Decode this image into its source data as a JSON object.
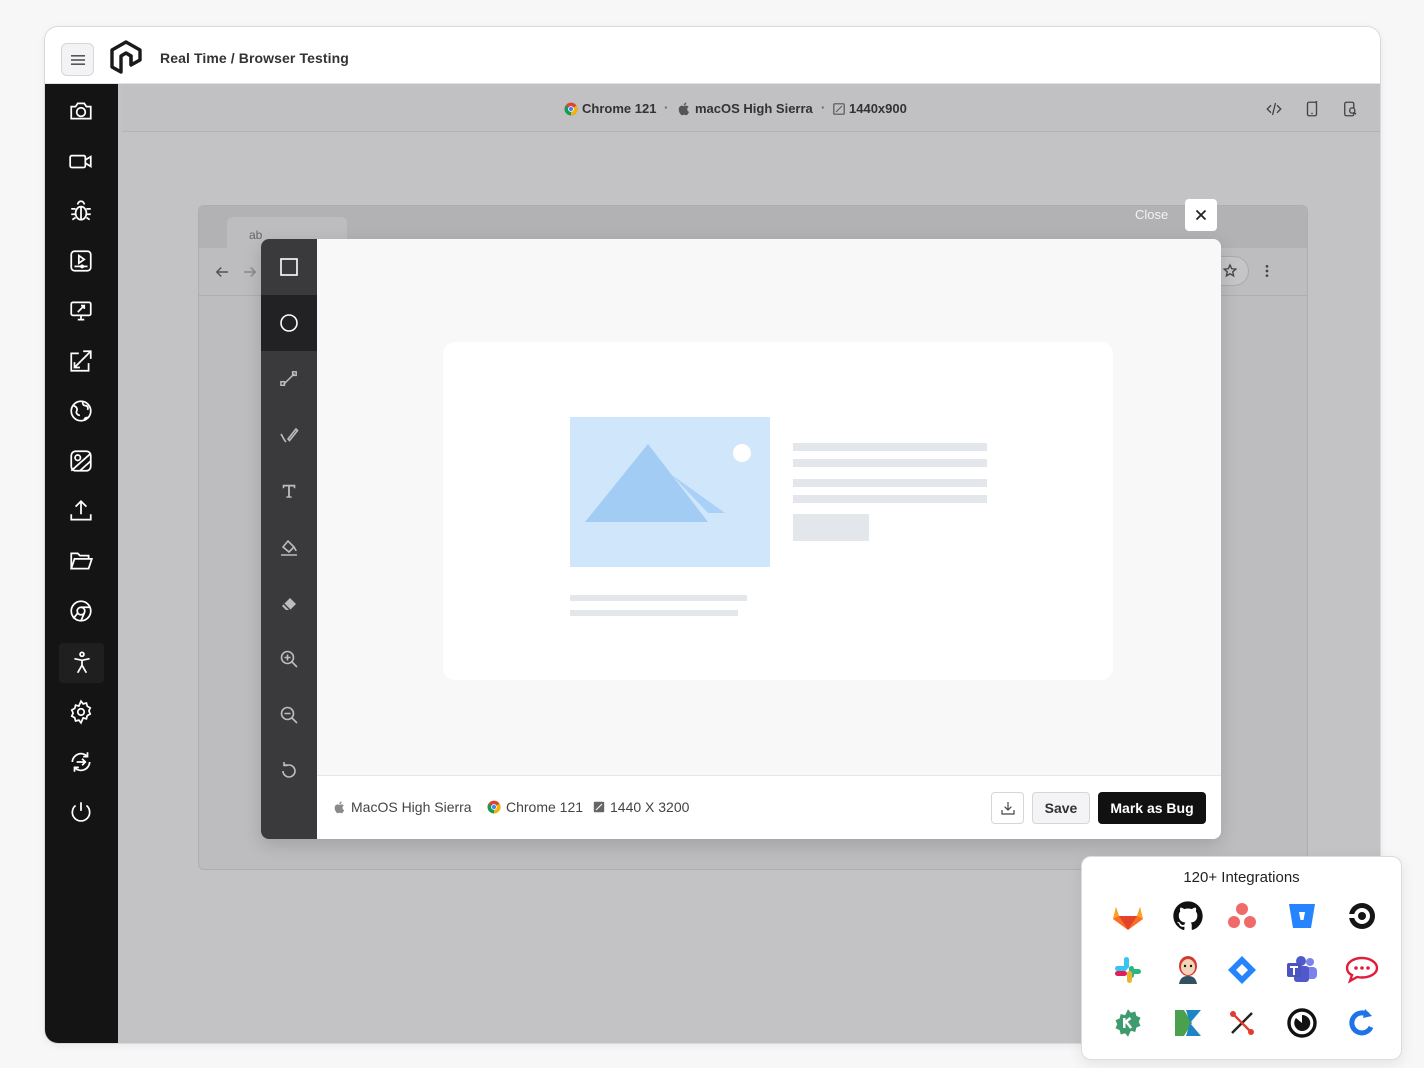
{
  "header": {
    "breadcrumb": "Real Time / Browser Testing"
  },
  "sidebar": {
    "items": [
      {
        "icon": "camera-icon"
      },
      {
        "icon": "video-icon"
      },
      {
        "icon": "bug-icon"
      },
      {
        "icon": "media-player-icon"
      },
      {
        "icon": "monitor-icon"
      },
      {
        "icon": "resize-icon"
      },
      {
        "icon": "globe-icon"
      },
      {
        "icon": "image-icon"
      },
      {
        "icon": "upload-icon"
      },
      {
        "icon": "folder-icon"
      },
      {
        "icon": "chrome-icon"
      },
      {
        "icon": "accessibility-icon"
      },
      {
        "icon": "settings-icon"
      },
      {
        "icon": "switch-icon"
      },
      {
        "icon": "power-icon"
      }
    ]
  },
  "session": {
    "browser": "Chrome 121",
    "os": "macOS High Sierra",
    "resolution": "1440x900"
  },
  "background_browser": {
    "tab_label": "ab"
  },
  "modal": {
    "close_label": "Close",
    "tools": [
      "rectangle-icon",
      "circle-icon",
      "arrow-icon",
      "pen-icon",
      "text-icon",
      "fill-icon",
      "eraser-icon",
      "zoom-in-icon",
      "zoom-out-icon",
      "undo-icon"
    ],
    "active_tool": "circle-icon",
    "footer": {
      "os": "MacOS High Sierra",
      "browser": "Chrome 121",
      "resolution": "1440 X 3200",
      "save_label": "Save",
      "bug_label": "Mark as Bug"
    }
  },
  "integrations": {
    "title": "120+ Integrations",
    "icons": [
      "gitlab-icon",
      "github-icon",
      "asana-icon",
      "bitbucket-icon",
      "circleci-icon",
      "slack-icon",
      "jenkins-icon",
      "jira-icon",
      "teams-icon",
      "rocketchat-icon",
      "gear-green-icon",
      "kubernetes-icon",
      "tools-icon",
      "timer-icon",
      "refresh-blue-icon"
    ]
  },
  "colors": {
    "sidebar": "#141414",
    "accent_dark": "#111111",
    "placeholder_blue": "#cfe6fb"
  }
}
